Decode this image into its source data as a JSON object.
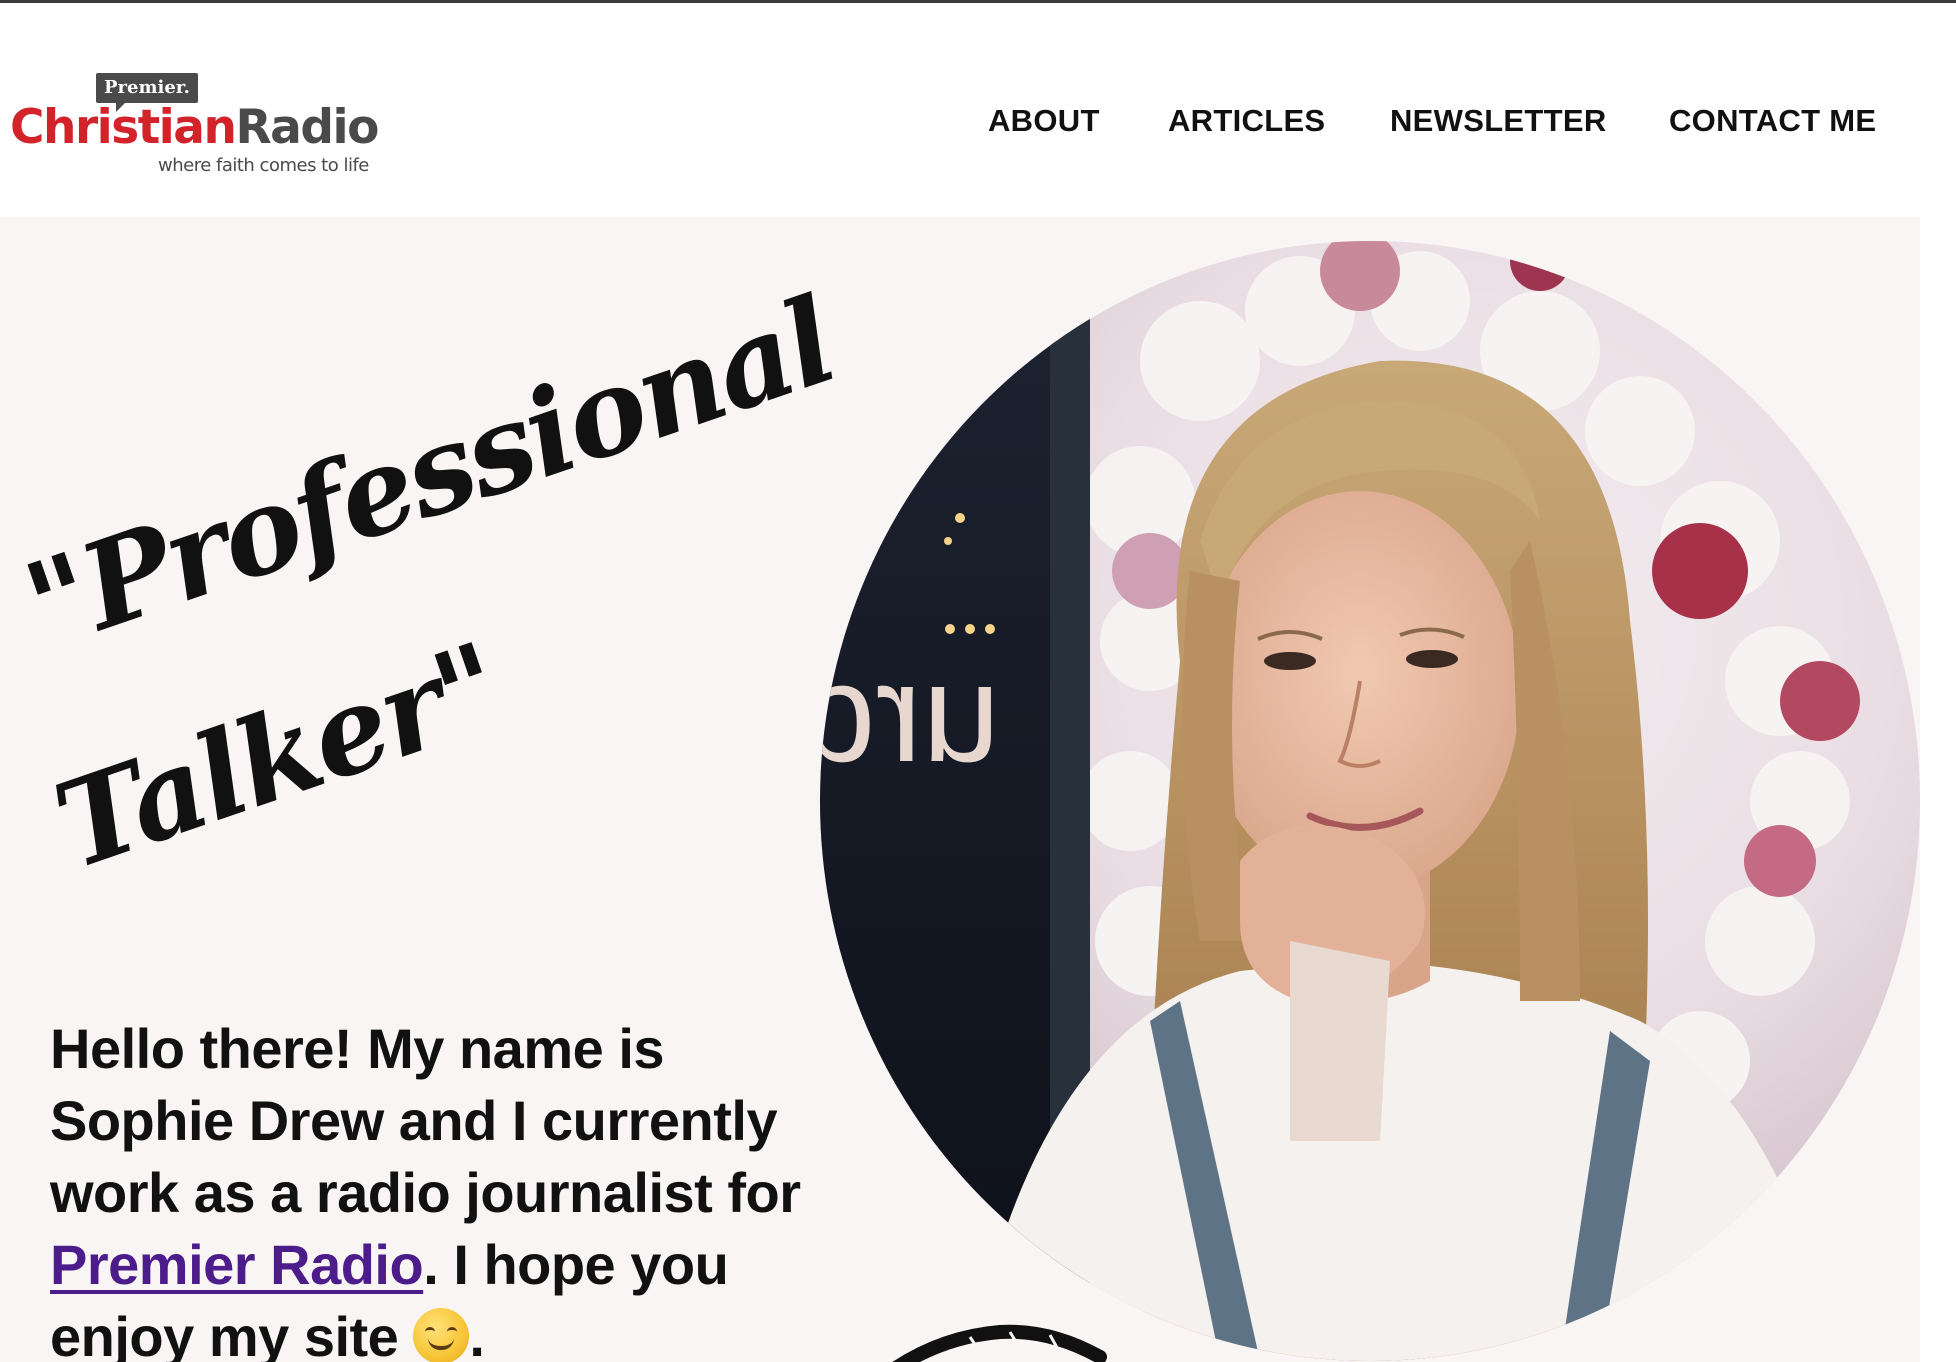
{
  "header": {
    "logo": {
      "premier_tag": "Premier.",
      "wordmark_part1": "Christian",
      "wordmark_part2": "Radio",
      "tagline": "where faith comes to life"
    },
    "nav": [
      "ABOUT",
      "ARTICLES",
      "NEWSLETTER",
      "CONTACT ME"
    ]
  },
  "hero": {
    "headline_line1": "\"Professional",
    "headline_line2": "Talker\"",
    "intro_before_link": "Hello there! My name is Sophie Drew and I currently work as a radio journalist for ",
    "intro_link": "Premier Radio",
    "intro_after_link": ". I hope you enjoy my site ",
    "intro_end": ".",
    "emoji": "smiling-face",
    "portrait_alt": "Photo of Sophie Drew",
    "window_lettering": "urd"
  },
  "colors": {
    "brand_red": "#d2232a",
    "brand_grey": "#4a4a4a",
    "hero_background": "#f8f5f4",
    "link_purple": "#4b1c8a",
    "text": "#111111"
  }
}
